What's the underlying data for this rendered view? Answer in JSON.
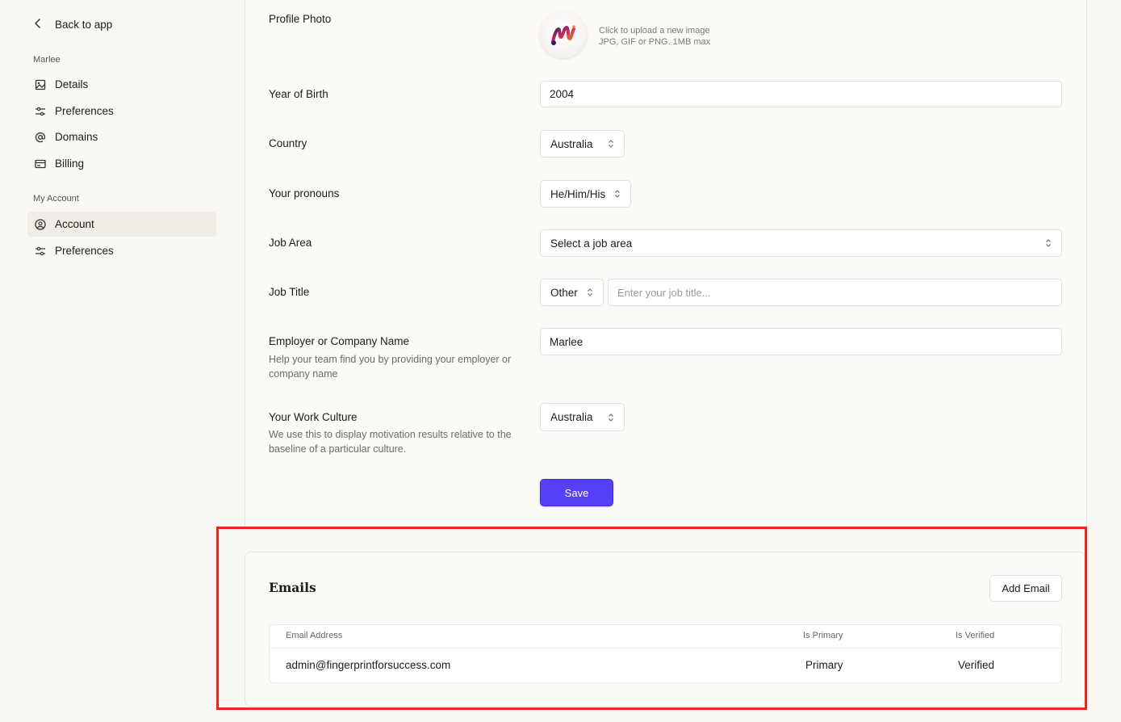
{
  "sidebar": {
    "back_label": "Back to app",
    "section1_label": "Marlee",
    "section1_items": [
      {
        "label": "Details",
        "icon": "image-icon"
      },
      {
        "label": "Preferences",
        "icon": "sliders-icon"
      },
      {
        "label": "Domains",
        "icon": "at-icon"
      },
      {
        "label": "Billing",
        "icon": "credit-card-icon"
      }
    ],
    "section2_label": "My Account",
    "section2_items": [
      {
        "label": "Account",
        "icon": "user-circle-icon",
        "active": true
      },
      {
        "label": "Preferences",
        "icon": "sliders-icon"
      }
    ]
  },
  "form": {
    "profile_photo_label": "Profile Photo",
    "upload_line1": "Click to upload a new image",
    "upload_line2": "JPG, GIF or PNG. 1MB max",
    "year_label": "Year of Birth",
    "year_value": "2004",
    "country_label": "Country",
    "country_value": "Australia",
    "pronouns_label": "Your pronouns",
    "pronouns_value": "He/Him/His",
    "job_area_label": "Job Area",
    "job_area_value": "Select a job area",
    "job_title_label": "Job Title",
    "job_title_type": "Other",
    "job_title_placeholder": "Enter your job title...",
    "employer_label": "Employer or Company Name",
    "employer_help": "Help your team find you by providing your employer or company name",
    "employer_value": "Marlee",
    "culture_label": "Your Work Culture",
    "culture_help": "We use this to display motivation results relative to the baseline of a particular culture.",
    "culture_value": "Australia",
    "save_label": "Save"
  },
  "emails": {
    "title": "Emails",
    "add_label": "Add Email",
    "columns": [
      "Email Address",
      "Is Primary",
      "Is Verified"
    ],
    "rows": [
      {
        "email": "admin@fingerprintforsuccess.com",
        "primary": "Primary",
        "verified": "Verified"
      }
    ]
  },
  "colors": {
    "accent": "#5540f5",
    "highlight": "#e8261a",
    "background": "#f9f8f5"
  }
}
